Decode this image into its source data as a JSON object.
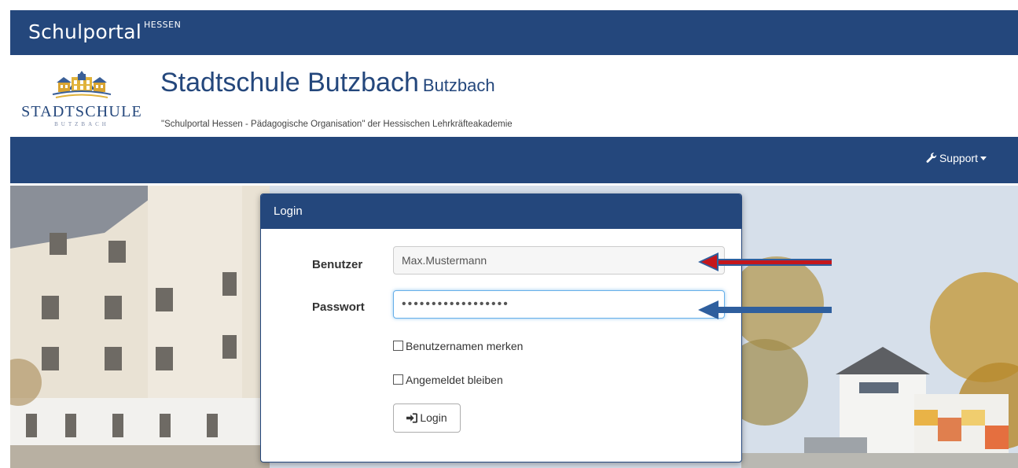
{
  "brand": {
    "name": "Schulportal",
    "region": "HESSEN"
  },
  "school": {
    "logo_text": "STADTSCHULE",
    "logo_subtext": "BUTZBACH",
    "name": "Stadtschule Butzbach",
    "city": "Butzbach",
    "subtitle": "\"Schulportal Hessen - Pädagogische Organisation\" der Hessischen Lehrkräfteakademie"
  },
  "nav": {
    "support_label": "Support"
  },
  "login": {
    "panel_title": "Login",
    "user_label": "Benutzer",
    "user_value": "Max.Mustermann",
    "password_label": "Passwort",
    "password_value": "••••••••••••••••••",
    "remember_label": "Benutzernamen merken",
    "stay_logged_label": "Angemeldet bleiben",
    "button_label": "Login"
  },
  "icons": {
    "support": "wrench-icon",
    "login_button": "sign-in-icon",
    "caret": "caret-down-icon",
    "checkbox": "checkbox-icon"
  },
  "colors": {
    "primary": "#24477c",
    "annotation_red": "#c4161c",
    "annotation_blue": "#2f5f9e",
    "focus": "#66afe9"
  }
}
